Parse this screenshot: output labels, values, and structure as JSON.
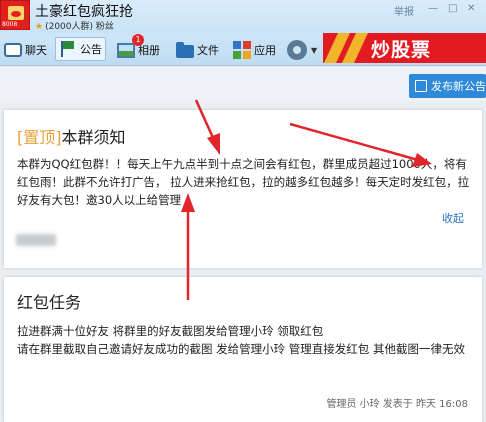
{
  "group": {
    "name": "土豪红包疯狂抢",
    "member_info": "(2000人群) 粉丝",
    "avatar_number": "8008"
  },
  "window": {
    "report": "举报"
  },
  "toolbar": {
    "items": [
      {
        "label": "聊天"
      },
      {
        "label": "公告"
      },
      {
        "label": "相册",
        "badge": "1"
      },
      {
        "label": "文件"
      },
      {
        "label": "应用"
      }
    ]
  },
  "ad": {
    "text": "炒股票",
    "color": "#e21b22"
  },
  "publish": {
    "label": "发布新公告"
  },
  "notice1": {
    "pin_label": "[置顶]",
    "title": "本群须知",
    "body": "本群为QQ红包群！！每天上午九点半到十点之间会有红包，群里成员超过1000人，将有红包雨！此群不允许打广告，  拉人进来抢红包，拉的越多红包越多！每天定时发红包，拉好友有大包！邀30人以上给管理 ！",
    "collapse": "收起"
  },
  "notice2": {
    "title": "红包任务",
    "line1": "拉进群满十位好友 将群里的好友截图发给管理小玲 领取红包",
    "line2": "请在群里截取自己邀请好友成功的截图 发给管理小玲 管理直接发红包 其他截图一律无效",
    "meta": "管理员 小玲  发表于  昨天 16:08"
  },
  "colors": {
    "accent": "#2e8ad8",
    "annotation_arrow": "#e0252b"
  }
}
